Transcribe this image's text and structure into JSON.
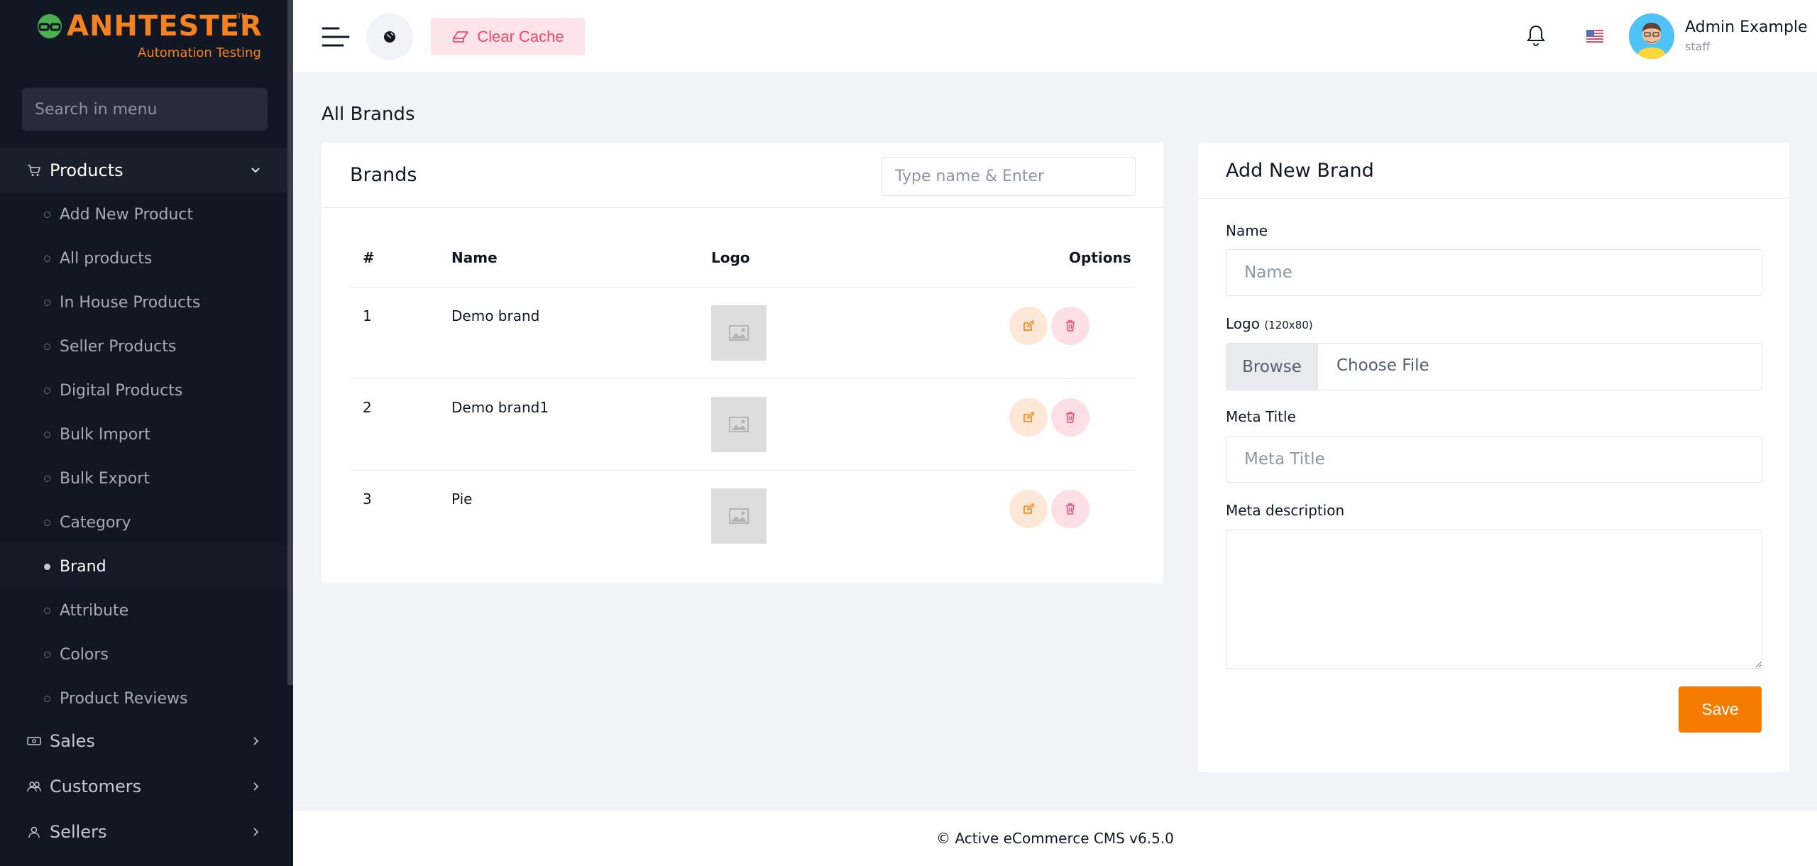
{
  "logo": {
    "text": "ANHTESTER",
    "tm": "TM",
    "subtitle": "Automation Testing"
  },
  "sidebar": {
    "search_placeholder": "Search in menu",
    "products": {
      "label": "Products",
      "items": [
        {
          "label": "Add New Product"
        },
        {
          "label": "All products"
        },
        {
          "label": "In House Products"
        },
        {
          "label": "Seller Products"
        },
        {
          "label": "Digital Products"
        },
        {
          "label": "Bulk Import"
        },
        {
          "label": "Bulk Export"
        },
        {
          "label": "Category"
        },
        {
          "label": "Brand",
          "active": true
        },
        {
          "label": "Attribute"
        },
        {
          "label": "Colors"
        },
        {
          "label": "Product Reviews"
        }
      ]
    },
    "groups": [
      {
        "label": "Sales",
        "icon": "money-icon"
      },
      {
        "label": "Customers",
        "icon": "users-icon"
      },
      {
        "label": "Sellers",
        "icon": "user-icon"
      }
    ]
  },
  "header": {
    "clear_cache_label": "Clear Cache",
    "user_name": "Admin Example",
    "user_role": "staff"
  },
  "page": {
    "title": "All Brands"
  },
  "brands_card": {
    "title": "Brands",
    "search_placeholder": "Type name & Enter",
    "columns": [
      "#",
      "Name",
      "Logo",
      "Options"
    ],
    "rows": [
      {
        "num": "1",
        "name": "Demo brand"
      },
      {
        "num": "2",
        "name": "Demo brand1"
      },
      {
        "num": "3",
        "name": "Pie"
      }
    ]
  },
  "add_brand": {
    "title": "Add New Brand",
    "name_label": "Name",
    "name_placeholder": "Name",
    "logo_label": "Logo",
    "logo_hint": "(120x80)",
    "browse_label": "Browse",
    "choose_file_label": "Choose File",
    "meta_title_label": "Meta Title",
    "meta_title_placeholder": "Meta Title",
    "meta_desc_label": "Meta description",
    "save_label": "Save"
  },
  "footer": {
    "text": "© Active eCommerce CMS v6.5.0"
  },
  "colors": {
    "accent": "#f57c00",
    "sidebar_bg": "#111723",
    "danger": "#ef486a"
  }
}
